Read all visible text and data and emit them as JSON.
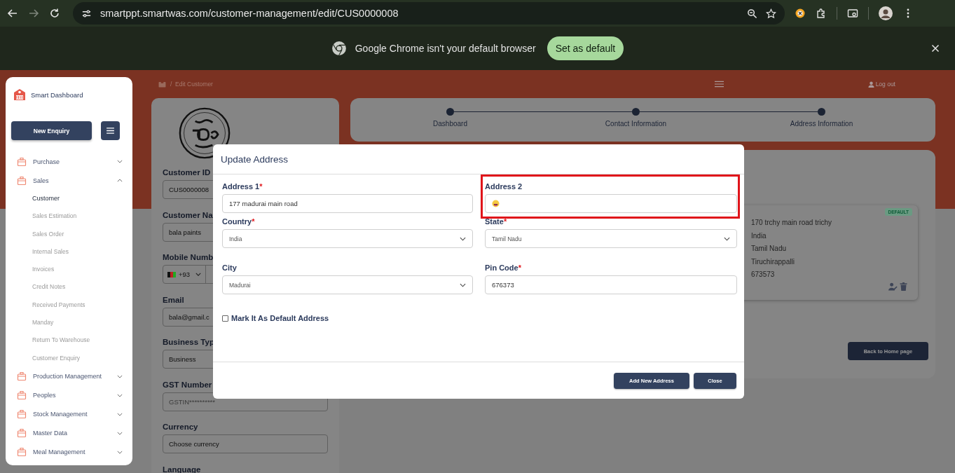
{
  "browser": {
    "url": "smartppt.smartwas.com/customer-management/edit/CUS0000008",
    "infobar": {
      "message": "Google Chrome isn't your default browser",
      "button": "Set as default"
    }
  },
  "sidebar": {
    "brand": "Smart Dashboard",
    "new_enquiry": "New Enquiry",
    "items": [
      {
        "label": "Purchase",
        "expanded": false
      },
      {
        "label": "Sales",
        "expanded": true,
        "children": [
          {
            "label": "Customer",
            "selected": true
          },
          {
            "label": "Sales Estimation",
            "selected": false
          },
          {
            "label": "Sales Order",
            "selected": false
          },
          {
            "label": "Internal Sales",
            "selected": false
          },
          {
            "label": "Invoices",
            "selected": false
          },
          {
            "label": "Credit Notes",
            "selected": false
          },
          {
            "label": "Received Payments",
            "selected": false
          },
          {
            "label": "Manday",
            "selected": false
          },
          {
            "label": "Return To Warehouse",
            "selected": false
          },
          {
            "label": "Customer Enquiry",
            "selected": false
          }
        ]
      },
      {
        "label": "Production Management",
        "expanded": false
      },
      {
        "label": "Peoples",
        "expanded": false
      },
      {
        "label": "Stock Management",
        "expanded": false
      },
      {
        "label": "Master Data",
        "expanded": false
      },
      {
        "label": "Meal Management",
        "expanded": false
      }
    ]
  },
  "breadcrumb": {
    "separator": "/",
    "current": "Edit Customer"
  },
  "header": {
    "logout": "Log out"
  },
  "customer_form": {
    "fields": [
      {
        "label": "Customer ID",
        "kind": "text",
        "value": "CUS0000008"
      },
      {
        "label": "Customer Na",
        "kind": "text",
        "value": "bala paints"
      },
      {
        "label": "Mobile Numb",
        "kind": "phone",
        "value": "+93"
      },
      {
        "label": "Email",
        "kind": "text",
        "value": "bala@gmail.c"
      },
      {
        "label": "Business Typ",
        "kind": "text",
        "value": "Business"
      },
      {
        "label": "GST Number",
        "kind": "text",
        "placeholder": "GSTIN**********"
      },
      {
        "label": "Currency",
        "kind": "text",
        "value": "Choose currency"
      },
      {
        "label": "Language",
        "kind": "none"
      }
    ]
  },
  "stepper": {
    "steps": [
      "Dashboard",
      "Contact Information",
      "Address Information"
    ]
  },
  "address_card": {
    "badge": "DEFAULT",
    "lines": [
      "170 trchy main road trichy",
      "India",
      "Tamil Nadu",
      "Tiruchirappalli",
      "673573"
    ]
  },
  "back_button": "Back to Home page",
  "modal": {
    "title": "Update Address",
    "fields": [
      {
        "label": "Address 1",
        "required_mark": "*",
        "kind": "input",
        "value": "177 madurai main road"
      },
      {
        "label": "Address 2",
        "kind": "input",
        "highlighted": true
      },
      {
        "label": "Country",
        "required_mark": "*",
        "kind": "select",
        "value": "India"
      },
      {
        "label": "State",
        "required_mark": "*",
        "kind": "select",
        "value": "Tamil Nadu"
      },
      {
        "label": "City",
        "kind": "select",
        "value": "Madurai"
      },
      {
        "label": "Pin Code",
        "required_mark": "*",
        "kind": "input",
        "value": "676373"
      }
    ],
    "checkbox": {
      "label": "Mark It As Default Address",
      "checked": false
    },
    "buttons": [
      "Add New Address",
      "Close"
    ]
  }
}
